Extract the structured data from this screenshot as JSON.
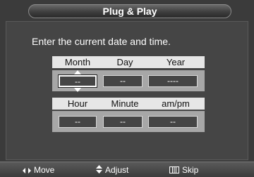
{
  "title": "Plug & Play",
  "instruction": "Enter the current date and time.",
  "date_headers": [
    "Month",
    "Day",
    "Year"
  ],
  "date_values": [
    "--",
    "--",
    "----"
  ],
  "time_headers": [
    "Hour",
    "Minute",
    "am/pm"
  ],
  "time_values": [
    "--",
    "--",
    "--"
  ],
  "footer": {
    "move_label": "Move",
    "adjust_label": "Adjust",
    "skip_label": "Skip",
    "move_icon": "left-right-arrows-icon",
    "adjust_icon": "up-down-arrows-icon",
    "skip_icon": "menu-icon"
  },
  "colors": {
    "background": "#3b3b3b",
    "header_row": "#e6e6e6",
    "field_row": "#a7a7a7"
  }
}
